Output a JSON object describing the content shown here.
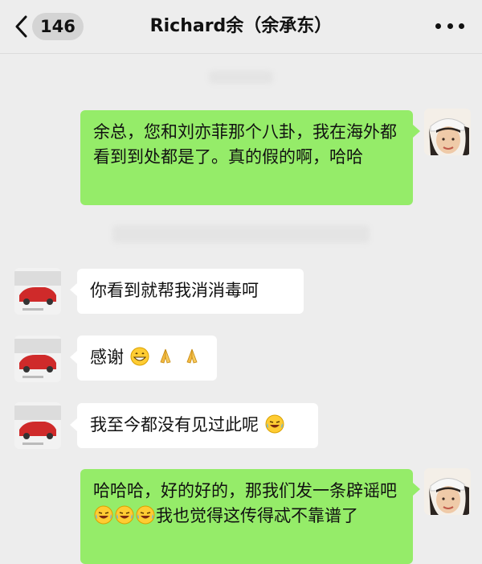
{
  "header": {
    "unread_count": "146",
    "title": "Richard余（余承东）",
    "back_icon": "chevron-left-icon",
    "more_icon": "more-dots-icon"
  },
  "colors": {
    "background": "#ededed",
    "sent_bubble": "#95ec69",
    "received_bubble": "#ffffff"
  },
  "messages": [
    {
      "side": "right",
      "text": "余总，您和刘亦菲那个八卦，我在海外都看到到处都是了。真的假的啊，哈哈"
    },
    {
      "side": "left",
      "text": "你看到就帮我消消毒呵"
    },
    {
      "side": "left",
      "text": "感谢",
      "emojis": [
        "grin-emoji",
        "pray-emoji",
        "pray-emoji"
      ]
    },
    {
      "side": "left",
      "text": "我至今都没有见过此呢",
      "emojis": [
        "laugh-cry-emoji"
      ]
    },
    {
      "side": "right",
      "text_a": "哈哈哈，好的好的，那我们发一条辟谣吧",
      "emojis": [
        "laugh-cry-emoji",
        "laugh-cry-emoji",
        "laugh-cry-emoji"
      ],
      "text_b": "我也觉得这传得忒不靠谱了"
    }
  ]
}
